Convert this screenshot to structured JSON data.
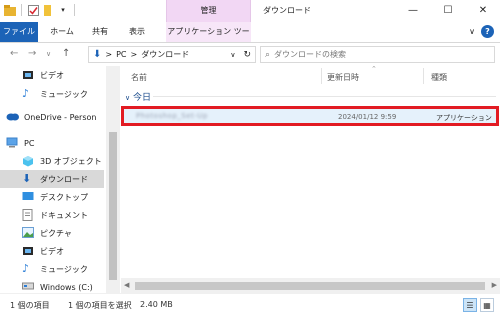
{
  "window": {
    "context_group": "管理",
    "title": "ダウンロード",
    "controls": [
      "—",
      "☐",
      "✕"
    ]
  },
  "ribbon": {
    "tabs": [
      "ファイル",
      "ホーム",
      "共有",
      "表示",
      "アプリケーション ツール"
    ],
    "help": "?",
    "expand": "∨"
  },
  "address": {
    "path": [
      "PC",
      "ダウンロード"
    ],
    "separator": ">",
    "search_placeholder": "ダウンロードの検索"
  },
  "sidebar": {
    "items": [
      {
        "label": "ビデオ",
        "icon": "video-icon"
      },
      {
        "label": "ミュージック",
        "icon": "music-icon"
      },
      {
        "label": "OneDrive - Person",
        "icon": "cloud-icon"
      },
      {
        "label": "PC",
        "icon": "pc-icon"
      },
      {
        "label": "3D オブジェクト",
        "icon": "cube-icon"
      },
      {
        "label": "ダウンロード",
        "icon": "download-icon",
        "selected": true
      },
      {
        "label": "デスクトップ",
        "icon": "desktop-icon"
      },
      {
        "label": "ドキュメント",
        "icon": "document-icon"
      },
      {
        "label": "ピクチャ",
        "icon": "picture-icon"
      },
      {
        "label": "ビデオ",
        "icon": "video-icon"
      },
      {
        "label": "ミュージック",
        "icon": "music-icon"
      },
      {
        "label": "Windows (C:)",
        "icon": "drive-icon"
      }
    ]
  },
  "columns": {
    "name": "名前",
    "modified": "更新日時",
    "type": "種類"
  },
  "group": {
    "label": "今日"
  },
  "file": {
    "name": "Photoshop_Set-Up",
    "modified": "2024/01/12 9:59",
    "type": "アプリケーション"
  },
  "status": {
    "items": "1 個の項目",
    "selected": "1 個の項目を選択",
    "size": "2.40 MB"
  },
  "colors": {
    "accent": "#1c63b7",
    "context_tab": "#f2d7f4",
    "highlight_border": "#e21b23",
    "selection": "#e5f1fb"
  }
}
